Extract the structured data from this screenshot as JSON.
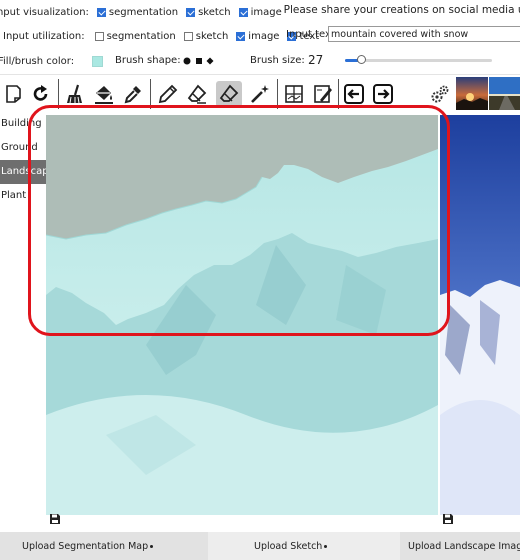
{
  "input_visualization": {
    "label": "Input visualization:",
    "options": [
      {
        "label": "segmentation",
        "checked": true
      },
      {
        "label": "sketch",
        "checked": true
      },
      {
        "label": "image",
        "checked": true
      }
    ]
  },
  "share_text": "Please share your creations on social media us",
  "input_utilization": {
    "label": "Input utilization:",
    "options": [
      {
        "label": "segmentation",
        "checked": false
      },
      {
        "label": "sketch",
        "checked": false
      },
      {
        "label": "image",
        "checked": true
      },
      {
        "label": "text",
        "checked": true
      }
    ]
  },
  "input_text": {
    "label": "Input text:",
    "value": "mountain covered with snow"
  },
  "brush": {
    "color_label": "Fill/brush color:",
    "color": "#aae8e2",
    "shape_label": "Brush shape:",
    "shapes": [
      "circle",
      "square",
      "diamond"
    ],
    "size_label": "Brush size:",
    "size_value": "27",
    "slider_fraction": 0.11
  },
  "toolbar": {
    "tools": [
      "new-page-icon",
      "redo-icon",
      "clear-broom-icon",
      "fill-bucket-icon",
      "eyedropper-icon",
      "pencil-icon",
      "eraser-icon",
      "eraser-icon-active",
      "magic-wand-icon",
      "layout-icon",
      "edit-image-icon",
      "arrow-left-icon",
      "arrow-right-icon",
      "settings-gears-icon"
    ]
  },
  "sidebar": {
    "items": [
      {
        "label": "Building",
        "active": false
      },
      {
        "label": "Ground",
        "active": false
      },
      {
        "label": "Landscape",
        "active": true
      },
      {
        "label": "Plant",
        "active": false
      }
    ]
  },
  "uploads": {
    "segmentation": "Upload Segmentation Map",
    "sketch": "Upload Sketch",
    "landscape": "Upload Landscape Imag"
  },
  "colors": {
    "canvas_fill": "#aebdb7",
    "highlight": "#e0141c",
    "accent": "#2b6fd6"
  }
}
